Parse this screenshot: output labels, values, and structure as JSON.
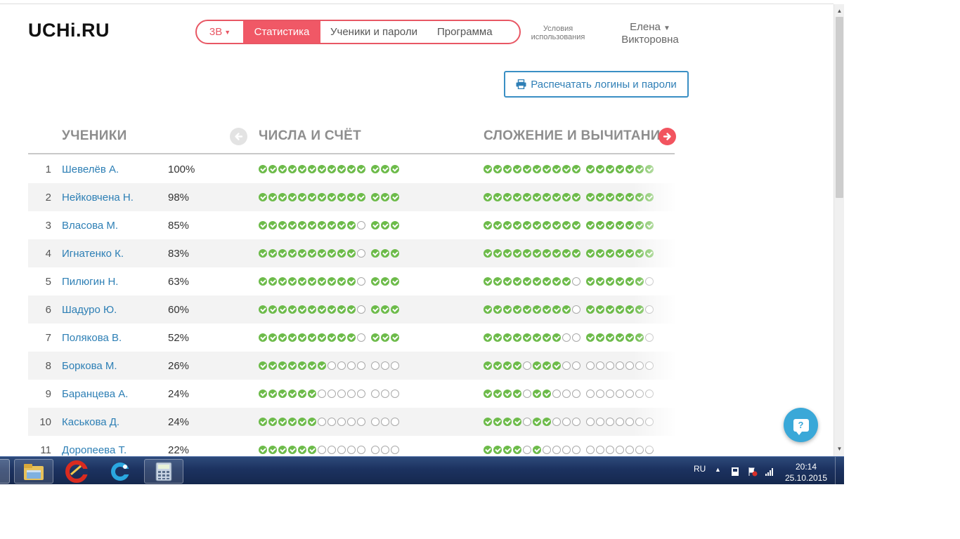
{
  "header": {
    "logo": "UCHi.RU",
    "class_selector": "3В",
    "tabs": [
      {
        "label": "Статистика",
        "active": true
      },
      {
        "label": "Ученики и пароли",
        "active": false
      },
      {
        "label": "Программа",
        "active": false
      }
    ],
    "terms_line1": "Условия",
    "terms_line2": "использования",
    "user_first_name": "Елена",
    "user_last_name": "Викторовна"
  },
  "print_button": {
    "label": "Распечатать логины и пароли",
    "icon": "printer-icon"
  },
  "table": {
    "col_students": "УЧЕНИКИ",
    "col_topic1": "ЧИСЛА И СЧЁТ",
    "col_topic2": "СЛОЖЕНИЕ И ВЫЧИТАНИЕ",
    "students": [
      {
        "num": "1",
        "name": "Шевелёв А.",
        "percent": "100%",
        "topic1": "11111111111|111",
        "topic2": "1111111111|1111111"
      },
      {
        "num": "2",
        "name": "Нейковчена Н.",
        "percent": "98%",
        "topic1": "11111111111|111",
        "topic2": "1111111111|1111111"
      },
      {
        "num": "3",
        "name": "Власова М.",
        "percent": "85%",
        "topic1": "11111111110|111",
        "topic2": "1111111111|1111111"
      },
      {
        "num": "4",
        "name": "Игнатенко К.",
        "percent": "83%",
        "topic1": "11111111110|111",
        "topic2": "1111111111|1111111"
      },
      {
        "num": "5",
        "name": "Пилюгин Н.",
        "percent": "63%",
        "topic1": "11111111110|111",
        "topic2": "1111111110|1111110"
      },
      {
        "num": "6",
        "name": "Шадуро Ю.",
        "percent": "60%",
        "topic1": "11111111110|111",
        "topic2": "1111111110|1111110"
      },
      {
        "num": "7",
        "name": "Полякова В.",
        "percent": "52%",
        "topic1": "11111111110|111",
        "topic2": "1111111100|1111110"
      },
      {
        "num": "8",
        "name": "Боркова М.",
        "percent": "26%",
        "topic1": "11111110000|000",
        "topic2": "1111011100|0000000"
      },
      {
        "num": "9",
        "name": "Баранцева А.",
        "percent": "24%",
        "topic1": "11111100000|000",
        "topic2": "1111011000|0000000"
      },
      {
        "num": "10",
        "name": "Каськова Д.",
        "percent": "24%",
        "topic1": "11111100000|000",
        "topic2": "1111011000|0000000"
      },
      {
        "num": "11",
        "name": "Доропеева Т.",
        "percent": "22%",
        "topic1": "11111100000|000",
        "topic2": "1111010000|0000000"
      }
    ]
  },
  "help_button": {
    "label": "?"
  },
  "taskbar": {
    "apps": [
      "file-manager-icon",
      "ccleaner-icon",
      "browser-icon",
      "calculator-icon"
    ],
    "language": "RU",
    "time": "20:14",
    "date": "25.10.2015"
  },
  "colors": {
    "accent": "#f05866",
    "link": "#2d7fb5",
    "done": "#6dbb4a"
  }
}
